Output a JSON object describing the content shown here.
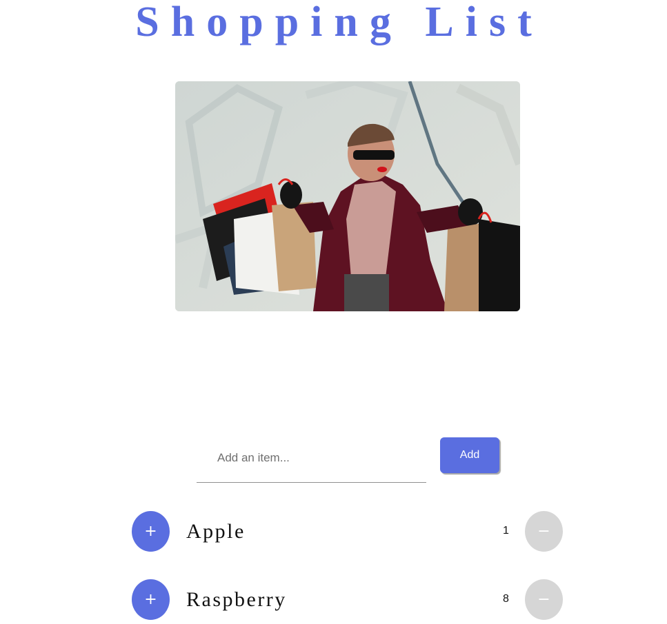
{
  "header": {
    "title": "Shopping List"
  },
  "hero": {
    "image_icon": "woman-with-shopping-bags-photo"
  },
  "add_form": {
    "input_value": "",
    "input_placeholder": "Add an item...",
    "add_label": "Add"
  },
  "items": [
    {
      "name": "Apple",
      "quantity": "1",
      "plus_label": "+",
      "minus_label": "−"
    },
    {
      "name": "Raspberry",
      "quantity": "8",
      "plus_label": "+",
      "minus_label": "−"
    }
  ],
  "colors": {
    "accent": "#5a6ee0",
    "minus_button": "#d6d6d6"
  }
}
